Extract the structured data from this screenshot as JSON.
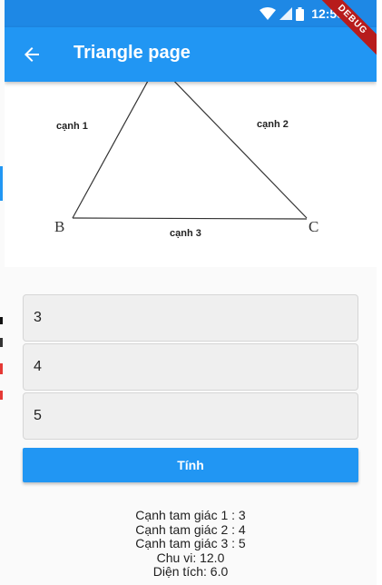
{
  "status": {
    "time": "12:58",
    "debug_banner": "DEBUG"
  },
  "appbar": {
    "title": "Triangle page"
  },
  "figure": {
    "side1": "cạnh 1",
    "side2": "cạnh 2",
    "side3": "cạnh 3",
    "vertex_b": "B",
    "vertex_c": "C"
  },
  "inputs": {
    "side1": "3",
    "side2": "4",
    "side3": "5"
  },
  "button": {
    "label": "Tính"
  },
  "results": {
    "line1": "Cạnh tam giác 1 : 3",
    "line2": "Cạnh tam giác 2 : 4",
    "line3": "Cạnh tam giác 3 : 5",
    "perimeter": "Chu vi: 12.0",
    "area": "Diện tích: 6.0"
  },
  "colors": {
    "primary": "#2196f3",
    "status": "#1e88e5",
    "debug": "#b71c1c"
  }
}
